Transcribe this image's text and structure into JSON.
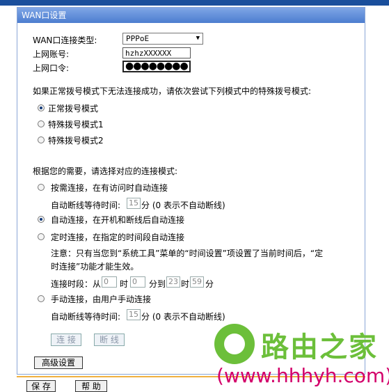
{
  "panel": {
    "title": "WAN口设置"
  },
  "wan": {
    "type_label": "WAN口连接类型:",
    "type_value": "PPPoE",
    "account_label": "上网账号:",
    "account_value": "hzhzXXXXXX",
    "password_label": "上网口令:",
    "password_mask": "●●●●●●●●"
  },
  "dial": {
    "instruction": "如果正常拨号模式下无法连接成功，请依次尝试下列模式中的特殊拨号模式:",
    "options": [
      {
        "label": "正常拨号模式",
        "selected": true
      },
      {
        "label": "特殊拨号模式1",
        "selected": false
      },
      {
        "label": "特殊拨号模式2",
        "selected": false
      }
    ]
  },
  "connect": {
    "instruction": "根据您的需要，请选择对应的连接模式:",
    "on_demand_label": "按需连接，在有访问时自动连接",
    "wait_label": "自动断线等待时间:",
    "on_demand_wait": "15",
    "minutes_hint": "分  (0 表示不自动断线)",
    "auto_label": "自动连接，在开机和断线后自动连接",
    "scheduled_label": "定时连接，在指定的时间段自动连接",
    "note_line1": "注意：只有当您到“系统工具”菜单的“时间设置”项设置了当前时间后，“定",
    "note_line2": "时连接”功能才能生效。",
    "period_label": "连接时段：从",
    "from_hour": "0",
    "hour_label": "时",
    "from_min": "0",
    "to_label": "分到",
    "to_hour": "23",
    "to_min": "59",
    "minute_label": "分",
    "manual_label": "手动连接，由用户手动连接",
    "manual_wait": "15",
    "selected": "auto"
  },
  "buttons": {
    "connect": "连 接",
    "disconnect": "断 线",
    "advanced": "高级设置",
    "save": "保 存",
    "help": "帮 助"
  },
  "watermark": {
    "brand": "路由之家",
    "url": "(www.hhhyh.com)"
  },
  "colors": {
    "title_bar": "#4c7dcf",
    "top_bar": "#1a4f9c",
    "accent_bottom": "#f0b040",
    "watermark_green": "#6cbf3a",
    "watermark_pink": "#d3006a"
  }
}
